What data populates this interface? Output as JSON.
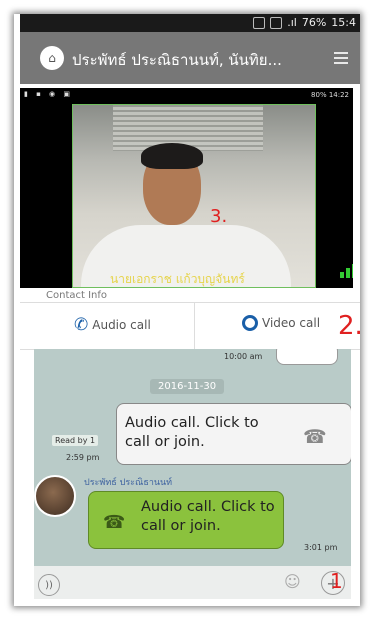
{
  "status_bar": {
    "battery": "76%",
    "time": "15:4"
  },
  "header": {
    "title": "ประพัทธ์  ประณิธานนท์, นันทิย..."
  },
  "video_call": {
    "status_left": "▮ ▪ ◉ ▣",
    "status_right": "80% 14:22",
    "caller_name": "นายเอกราช แก้วบุญจันทร์",
    "marker": "3."
  },
  "contact_info_label": "Contact Info",
  "call_buttons": {
    "audio_label": "Audio call",
    "video_label": "Video call",
    "marker": "2."
  },
  "chat": {
    "prev_time": "10:00 am",
    "date_chip": "2016-11-30",
    "msg1": {
      "text_line1": "Audio call. Click to",
      "text_line2": "call or join.",
      "read_by": "Read by 1",
      "time": "2:59 pm"
    },
    "msg2": {
      "sender": "ประพัทธ์  ประณิธานนท์",
      "text_line1": "Audio call. Click to",
      "text_line2": "call or join.",
      "time": "3:01 pm"
    }
  },
  "input_bar": {
    "marker": "1"
  }
}
